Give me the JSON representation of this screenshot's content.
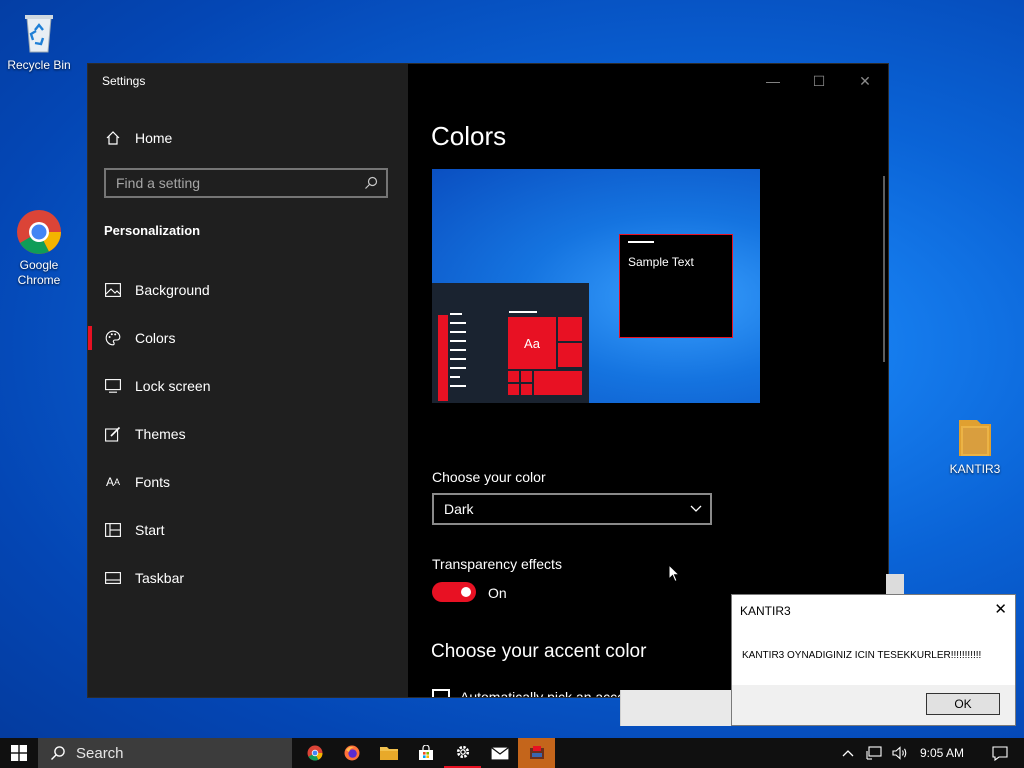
{
  "desktop": {
    "icons": [
      {
        "label": "Recycle Bin"
      },
      {
        "label": "Google Chrome"
      },
      {
        "label": "KANTIR3"
      }
    ]
  },
  "window": {
    "title": "Settings",
    "controls": {
      "minimize": "—",
      "maximize": "☐",
      "close": "✕"
    }
  },
  "sidebar": {
    "home_label": "Home",
    "search_placeholder": "Find a setting",
    "section_title": "Personalization",
    "items": [
      {
        "label": "Background",
        "icon": "picture-icon"
      },
      {
        "label": "Colors",
        "icon": "palette-icon",
        "active": true
      },
      {
        "label": "Lock screen",
        "icon": "lock-screen-icon"
      },
      {
        "label": "Themes",
        "icon": "brush-icon"
      },
      {
        "label": "Fonts",
        "icon": "font-icon"
      },
      {
        "label": "Start",
        "icon": "start-tiles-icon"
      },
      {
        "label": "Taskbar",
        "icon": "taskbar-icon"
      }
    ]
  },
  "main": {
    "title": "Colors",
    "preview": {
      "sample_text": "Sample Text",
      "tile_text": "Aa"
    },
    "choose_color_label": "Choose your color",
    "choose_color_value": "Dark",
    "transparency_label": "Transparency effects",
    "transparency_value": "On",
    "accent_heading": "Choose your accent color",
    "auto_pick_label": "Automatically pick an accent color from my background"
  },
  "dialog": {
    "title": "KANTIR3",
    "message": "KANTIR3 OYNADIGINIZ ICIN TESEKKURLER!!!!!!!!!!!",
    "ok_label": "OK"
  },
  "taskbar": {
    "search_label": "Search",
    "time": "9:05 AM"
  },
  "colors": {
    "accent": "#e81123",
    "window_bg": "#000000",
    "sidebar_bg": "#1f1f1f",
    "taskbar_bg": "#101010"
  }
}
